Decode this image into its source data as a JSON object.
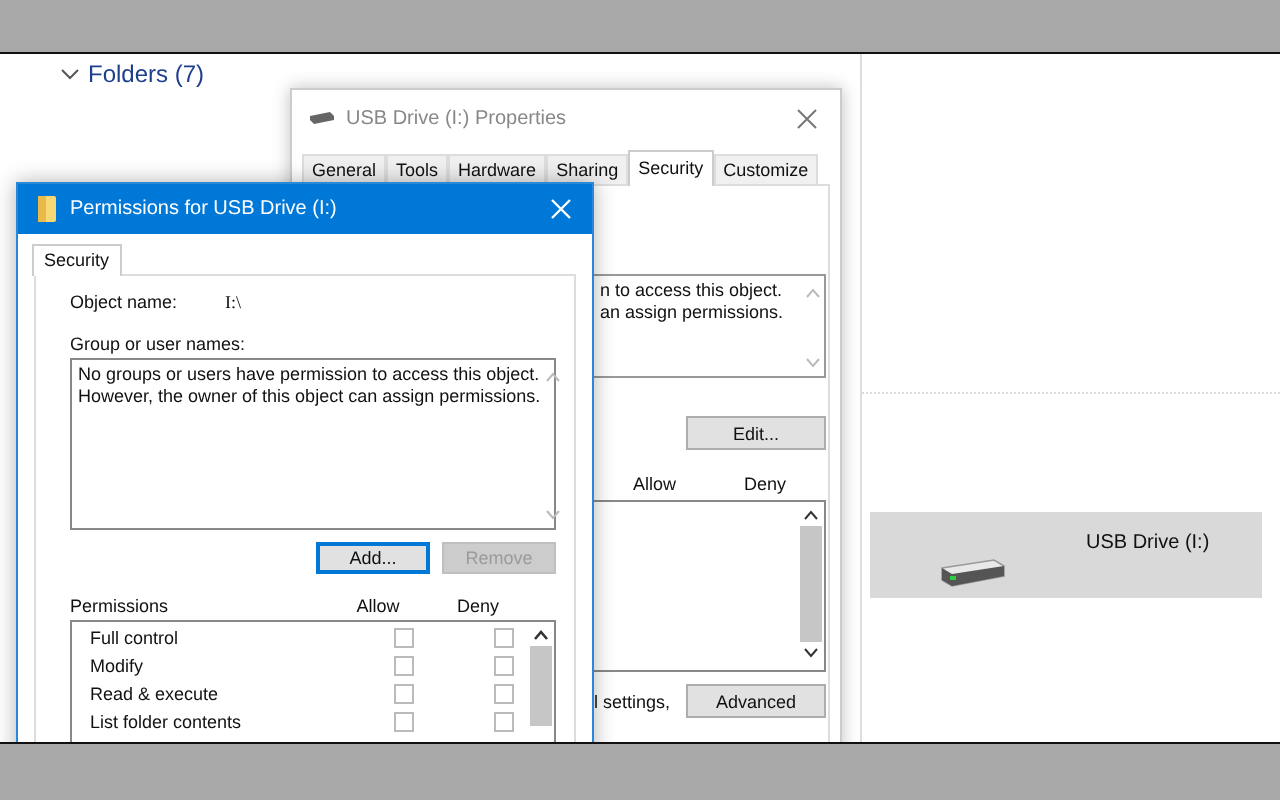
{
  "explorer": {
    "group_header": "Folders (7)",
    "expanded": true,
    "drive": {
      "label": "USB Drive (I:)",
      "selected": true
    }
  },
  "properties_dialog": {
    "title": "USB Drive (I:) Properties",
    "tabs": [
      {
        "label": "General",
        "selected": false
      },
      {
        "label": "Tools",
        "selected": false
      },
      {
        "label": "Hardware",
        "selected": false
      },
      {
        "label": "Sharing",
        "selected": false
      },
      {
        "label": "Security",
        "selected": true
      },
      {
        "label": "Customize",
        "selected": false
      }
    ],
    "group_text_lines": [
      "n to access this object.",
      "an assign permissions."
    ],
    "edit_button": "Edit...",
    "columns": [
      "Allow",
      "Deny"
    ],
    "advanced_note": "l settings,",
    "advanced_button": "Advanced"
  },
  "permissions_dialog": {
    "title": "Permissions for USB Drive (I:)",
    "tabs": [
      {
        "label": "Security",
        "selected": true
      }
    ],
    "object_name_label": "Object name:",
    "object_name": "I:\\",
    "group_label": "Group or user names:",
    "group_text_lines": [
      "No groups or users have permission to access this object.",
      "However, the owner of this object can assign permissions."
    ],
    "buttons": [
      {
        "label": "Add...",
        "focused": true,
        "disabled": false
      },
      {
        "label": "Remove",
        "focused": false,
        "disabled": true
      }
    ],
    "permissions_header": "Permissions",
    "columns": [
      "Allow",
      "Deny"
    ],
    "permissions": [
      {
        "name": "Full control",
        "allow": false,
        "deny": false
      },
      {
        "name": "Modify",
        "allow": false,
        "deny": false
      },
      {
        "name": "Read & execute",
        "allow": false,
        "deny": false
      },
      {
        "name": "List folder contents",
        "allow": false,
        "deny": false
      }
    ]
  }
}
